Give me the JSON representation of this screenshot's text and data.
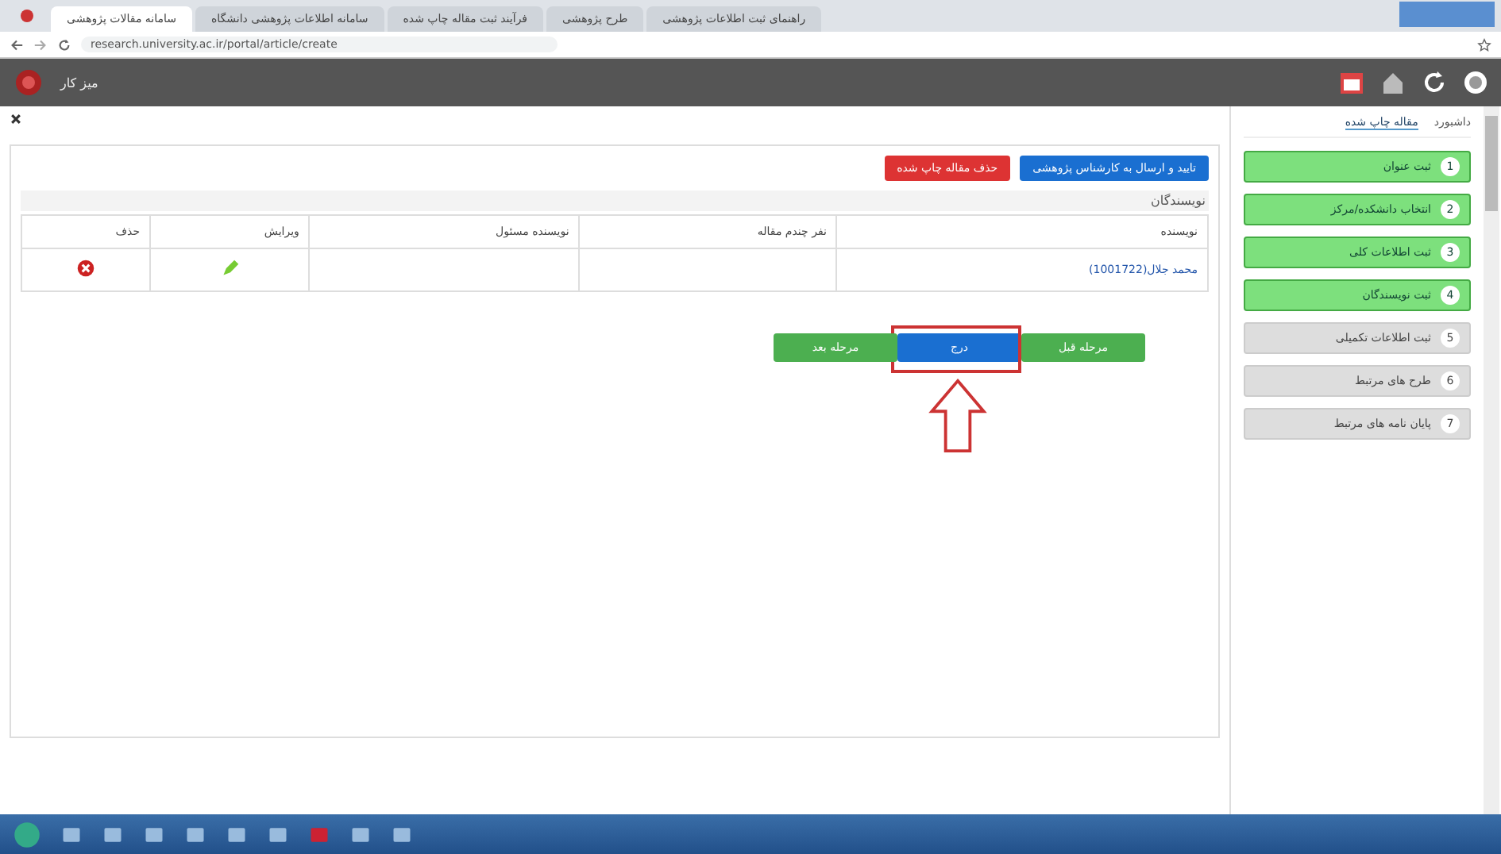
{
  "browser": {
    "tabs": [
      {
        "title": "راهنمای ثبت اطلاعات پژوهشی",
        "selected": false
      },
      {
        "title": "طرح پژوهشی",
        "selected": false
      },
      {
        "title": "فرآیند ثبت مقاله چاپ شده",
        "selected": false
      },
      {
        "title": "سامانه اطلاعات پژوهشی دانشگاه",
        "selected": false
      },
      {
        "title": "سامانه مقالات پژوهشی",
        "selected": true
      }
    ],
    "address": "research.university.ac.ir/portal/article/create"
  },
  "header": {
    "title": "میز کار"
  },
  "main": {
    "actions": [
      {
        "label": "تایید و ارسال به کارشناس پژوهشی",
        "kind": "primary"
      },
      {
        "label": "حذف مقاله چاپ شده",
        "kind": "danger"
      }
    ],
    "section_title": "نویسندگان",
    "table": {
      "columns": [
        "نویسنده",
        "نفر چندم مقاله",
        "نویسنده مسئول",
        "ویرایش",
        "حذف"
      ],
      "rows": [
        {
          "author": "محمد جلال(1001722)",
          "position": "",
          "corresponding": ""
        }
      ]
    },
    "steps_nav": [
      {
        "label": "مرحله قبل",
        "kind": "success",
        "highlighted": false
      },
      {
        "label": "درج",
        "kind": "primary",
        "highlighted": true
      },
      {
        "label": "مرحله بعد",
        "kind": "success",
        "highlighted": false
      }
    ]
  },
  "sidebar": {
    "tabs": [
      {
        "label": "داشبورد",
        "selected": false
      },
      {
        "label": "مقاله چاپ شده",
        "selected": true
      }
    ],
    "steps": [
      {
        "number": "1",
        "label": "ثبت عنوان",
        "done": true
      },
      {
        "number": "2",
        "label": "انتخاب دانشکده/مرکز",
        "done": true
      },
      {
        "number": "3",
        "label": "ثبت اطلاعات کلی",
        "done": true
      },
      {
        "number": "4",
        "label": "ثبت نویسندگان",
        "done": true
      },
      {
        "number": "5",
        "label": "ثبت اطلاعات تکمیلی",
        "done": false
      },
      {
        "number": "6",
        "label": "طرح های مرتبط",
        "done": false
      },
      {
        "number": "7",
        "label": "پایان نامه های مرتبط",
        "done": false
      }
    ]
  }
}
